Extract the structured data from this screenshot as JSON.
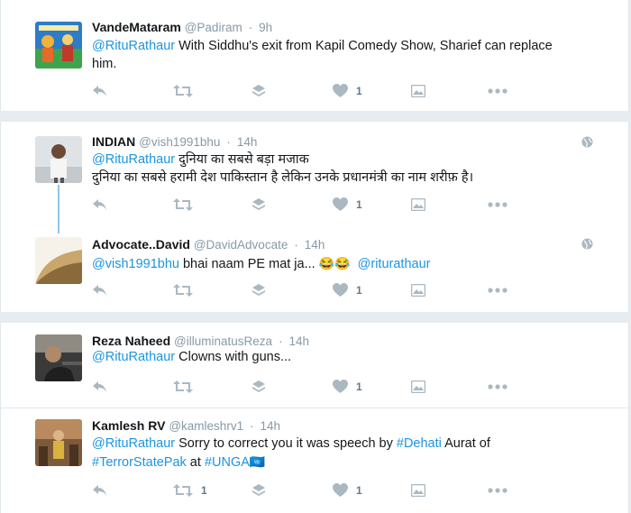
{
  "tweets": [
    {
      "name": "VandeMataram",
      "handle": "@Padiram",
      "time": "9h",
      "mention": "@RituRathaur",
      "text": " With Siddhu's exit from Kapil Comedy Show, Sharief can replace",
      "text2": "him.",
      "retweets": "",
      "likes": "1"
    },
    {
      "name": "INDIAN",
      "handle": "@vish1991bhu",
      "time": "14h",
      "mention": "@RituRathaur",
      "text": " दुनिया का सबसे बड़ा मजाक",
      "text2": "दुनिया का सबसे हरामी देश पाकिस्तान है लेकिन उनके प्रधानमंत्री का नाम शरीफ़ है।",
      "retweets": "",
      "likes": "1"
    },
    {
      "name": "Advocate..David",
      "handle": "@DavidAdvocate",
      "time": "14h",
      "mention": "@vish1991bhu",
      "text": " bhai naam PE mat ja... ",
      "emoji": "😂😂",
      "mention2": "@riturathaur",
      "retweets": "",
      "likes": "1"
    },
    {
      "name": "Reza Naheed",
      "handle": "@illuminatusReza",
      "time": "14h",
      "mention": "@RituRathaur",
      "text": " Clowns with guns...",
      "retweets": "",
      "likes": "1"
    },
    {
      "name": "Kamlesh RV",
      "handle": "@kamleshrv1",
      "time": "14h",
      "mention": "@RituRathaur",
      "text": " Sorry to correct you it was speech by ",
      "hashtag": "#Dehati",
      "text_after": " Aurat of",
      "hashtag2": "#TerrorStatePak",
      "text3": " at ",
      "hashtag3": "#UNGA",
      "emoji": "🇺🇳",
      "retweets": "1",
      "likes": "1"
    }
  ],
  "colors": {
    "link": "#1b95e0",
    "icon": "#aab8c2",
    "muted": "#8899a6",
    "background": "#e6ecf0"
  },
  "icons": [
    "reply-icon",
    "retweet-icon",
    "layers-icon",
    "heart-icon",
    "image-icon",
    "more-icon",
    "globe-icon"
  ]
}
